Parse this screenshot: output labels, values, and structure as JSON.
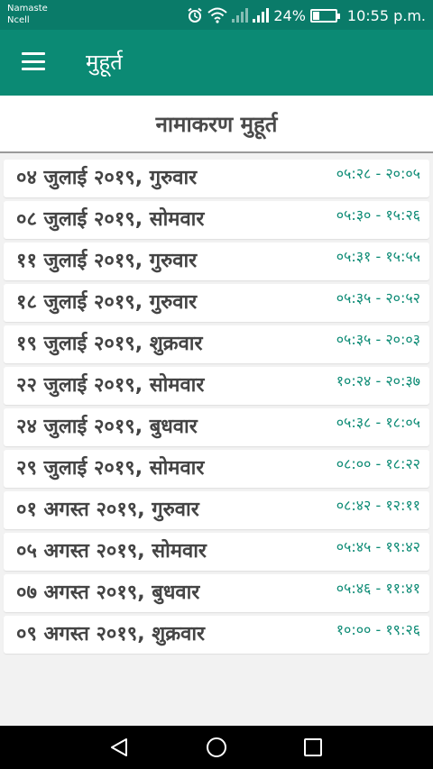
{
  "status_bar": {
    "carrier_line1": "Namaste",
    "carrier_line2": "Ncell",
    "battery": "24%",
    "time": "10:55 p.m."
  },
  "app_bar": {
    "title": "मुहूर्त"
  },
  "section": {
    "title": "नामाकरण मुहूर्त"
  },
  "muhurta_list": [
    {
      "date": "०४ जुलाई २०१९, गुरुवार",
      "time": "०५:२८ - २०:०५"
    },
    {
      "date": "०८ जुलाई २०१९, सोमवार",
      "time": "०५:३० - १५:२६"
    },
    {
      "date": "११ जुलाई २०१९, गुरुवार",
      "time": "०५:३१ - १५:५५"
    },
    {
      "date": "१८ जुलाई २०१९, गुरुवार",
      "time": "०५:३५ - २०:५२"
    },
    {
      "date": "१९ जुलाई २०१९, शुक्रवार",
      "time": "०५:३५ - २०:०३"
    },
    {
      "date": "२२ जुलाई २०१९, सोमवार",
      "time": "१०:२४ - २०:३७"
    },
    {
      "date": "२४ जुलाई २०१९, बुधवार",
      "time": "०५:३८ - १८:०५"
    },
    {
      "date": "२९ जुलाई २०१९, सोमवार",
      "time": "०८:०० - १८:२२"
    },
    {
      "date": "०१ अगस्त २०१९, गुरुवार",
      "time": "०८:४२ - १२:११"
    },
    {
      "date": "०५ अगस्त २०१९, सोमवार",
      "time": "०५:४५ - १९:४२"
    },
    {
      "date": "०७ अगस्त २०१९, बुधवार",
      "time": "०५:४६ - ११:४१"
    },
    {
      "date": "०९ अगस्त २०१९, शुक्रवार",
      "time": "१०:०० - १९:२६"
    }
  ],
  "icons": {
    "menu": "hamburger-menu-icon",
    "alarm": "alarm-icon",
    "wifi": "wifi-icon",
    "signal": "signal-icon",
    "battery": "battery-icon",
    "back": "back-triangle-icon",
    "home": "home-circle-icon",
    "recent": "recent-apps-square-icon"
  },
  "colors": {
    "status_bar": "#0a7b69",
    "app_bar": "#0b8a74",
    "accent_time": "#0b8a74",
    "date_text": "#444444",
    "header_text": "#4a4a4a"
  }
}
